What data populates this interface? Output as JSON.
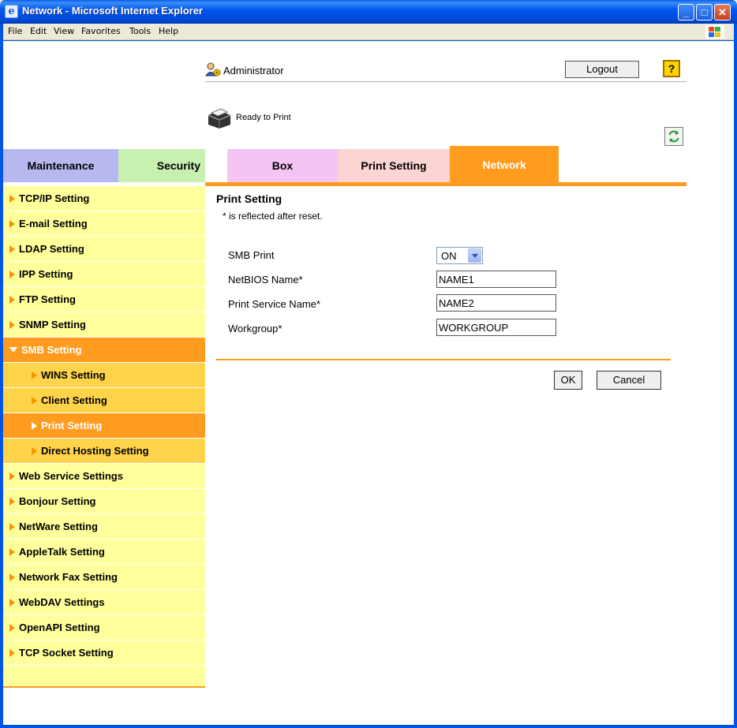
{
  "window": {
    "title": "Network - Microsoft Internet Explorer",
    "menu": [
      "File",
      "Edit",
      "View",
      "Favorites",
      "Tools",
      "Help"
    ]
  },
  "header": {
    "user": "Administrator",
    "logout_label": "Logout",
    "help_label": "?",
    "status": "Ready to Print"
  },
  "tabs": [
    {
      "label": "Maintenance",
      "color": "#b8b8f0"
    },
    {
      "label": "Security",
      "color": "#c8f0b0"
    },
    {
      "label": "Box",
      "color": "#f4c4f4"
    },
    {
      "label": "Print Setting",
      "color": "#fcd4d4"
    },
    {
      "label": "Network",
      "color": "#ff9c20",
      "active": true
    }
  ],
  "sidebar": {
    "items": [
      {
        "label": "TCP/IP Setting"
      },
      {
        "label": "E-mail Setting"
      },
      {
        "label": "LDAP Setting"
      },
      {
        "label": "IPP Setting"
      },
      {
        "label": "FTP Setting"
      },
      {
        "label": "SNMP Setting"
      },
      {
        "label": "SMB Setting",
        "expanded": true
      },
      {
        "label": "WINS Setting",
        "sub": true
      },
      {
        "label": "Client Setting",
        "sub": true
      },
      {
        "label": "Print Setting",
        "sub": true,
        "active": true
      },
      {
        "label": "Direct Hosting Setting",
        "sub": true
      },
      {
        "label": "Web Service Settings"
      },
      {
        "label": "Bonjour Setting"
      },
      {
        "label": "NetWare Setting"
      },
      {
        "label": "AppleTalk Setting"
      },
      {
        "label": "Network Fax Setting"
      },
      {
        "label": "WebDAV Settings"
      },
      {
        "label": "OpenAPI Setting"
      },
      {
        "label": "TCP Socket Setting"
      }
    ]
  },
  "main": {
    "title": "Print Setting",
    "note": "* is reflected after reset.",
    "fields": {
      "smb_print": {
        "label": "SMB Print",
        "value": "ON"
      },
      "netbios_name": {
        "label": "NetBIOS Name*",
        "value": "NAME1"
      },
      "print_service_name": {
        "label": "Print Service Name*",
        "value": "NAME2"
      },
      "workgroup": {
        "label": "Workgroup*",
        "value": "WORKGROUP"
      }
    },
    "ok_label": "OK",
    "cancel_label": "Cancel"
  },
  "colors": {
    "accent": "#ff9c20",
    "sidebar_bg": "#ffff9c",
    "sub_bg": "#ffd44a"
  }
}
